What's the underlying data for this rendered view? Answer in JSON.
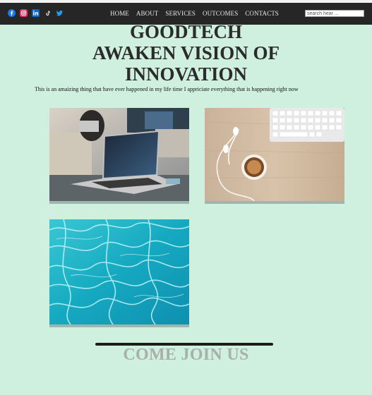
{
  "nav": {
    "social": [
      {
        "name": "facebook-icon",
        "color": "#1877f2"
      },
      {
        "name": "instagram-icon",
        "color": "#e1306c"
      },
      {
        "name": "linkedin-icon",
        "color": "#0a66c2"
      },
      {
        "name": "tiktok-icon",
        "color": "#ffffff"
      },
      {
        "name": "twitter-icon",
        "color": "#1da1f2"
      }
    ],
    "menu": [
      "HOME",
      "ABOUT",
      "SERVICES",
      "OUTCOMES",
      "CONTACTS"
    ],
    "search_placeholder": "search hear ..."
  },
  "hero": {
    "line1": "GOODTECH",
    "line2": "AWAKEN VISION OF",
    "line3": "INNOVATION",
    "tagline": "This is an amaizing thing that have ever happened in my life time I appriciate everything that is happening right now"
  },
  "gallery": {
    "items": [
      {
        "name": "laptop-photo"
      },
      {
        "name": "desk-coffee-photo"
      },
      {
        "name": "pool-water-photo"
      }
    ]
  },
  "cta": {
    "label": "COME JOIN US"
  },
  "colors": {
    "background": "#cfefdf",
    "navbar": "#262626",
    "heading": "#2b2b2b",
    "cta": "#a7b0ab"
  }
}
